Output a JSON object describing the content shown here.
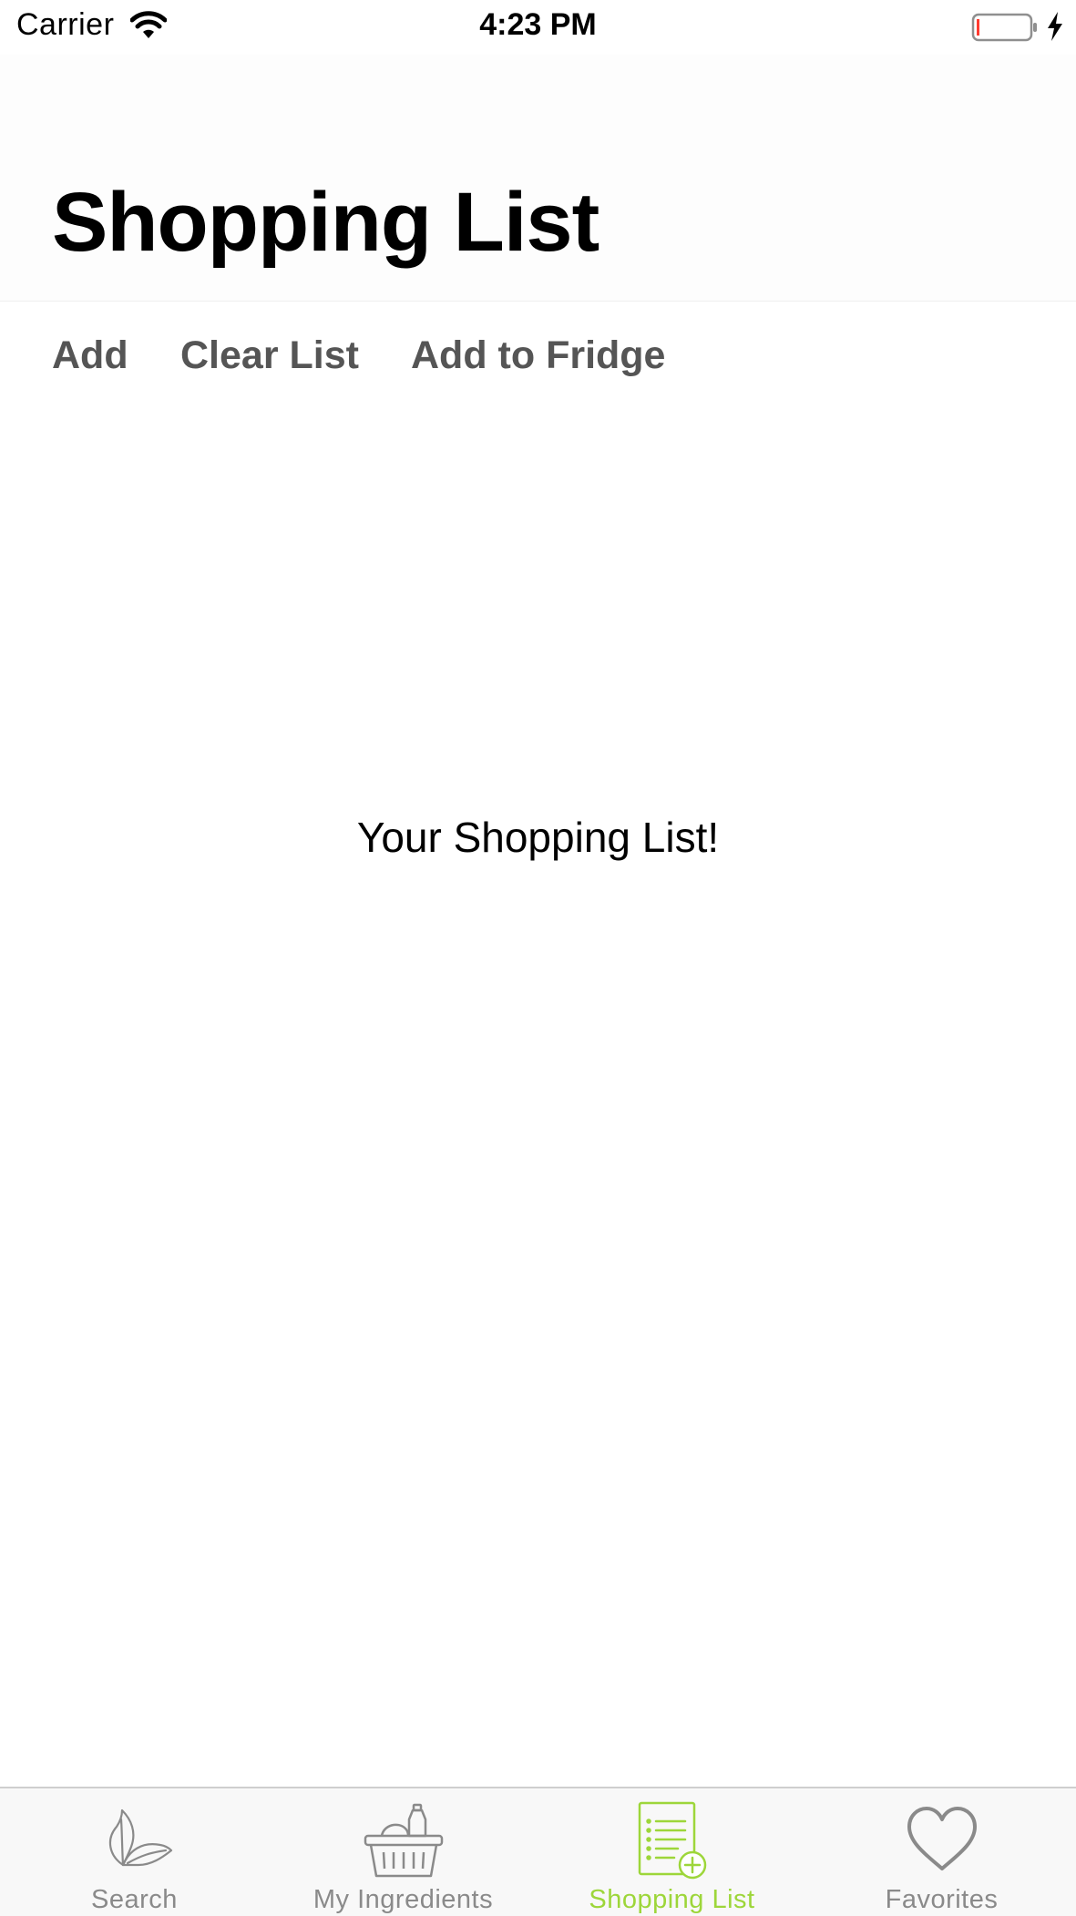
{
  "status_bar": {
    "carrier": "Carrier",
    "time": "4:23 PM",
    "icons": [
      "wifi-icon",
      "battery-icon",
      "charging-bolt-icon"
    ]
  },
  "header": {
    "title": "Shopping List"
  },
  "toolbar": {
    "add_label": "Add",
    "clear_label": "Clear List",
    "fridge_label": "Add to Fridge"
  },
  "main": {
    "empty_message": "Your Shopping List!"
  },
  "tab_bar": {
    "active_color": "#9dd63a",
    "inactive_color": "#8a8a8a",
    "tabs": [
      {
        "label": "Search",
        "icon": "leaf-icon",
        "active": false
      },
      {
        "label": "My Ingredients",
        "icon": "basket-icon",
        "active": false
      },
      {
        "label": "Shopping List",
        "icon": "list-add-icon",
        "active": true
      },
      {
        "label": "Favorites",
        "icon": "heart-icon",
        "active": false
      }
    ]
  }
}
